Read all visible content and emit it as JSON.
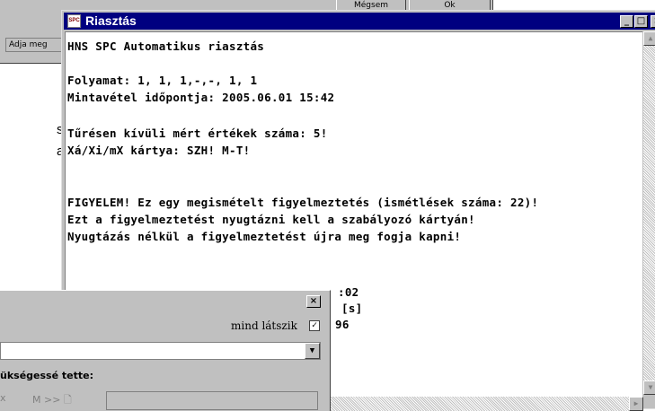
{
  "background_window": {
    "buttons": [
      "Mégsem",
      "Ok"
    ],
    "prompt_text": "Adja meg"
  },
  "side_text": [
    "s",
    "a"
  ],
  "alert": {
    "title": "Riasztás",
    "icon_label": "SPC",
    "controls": {
      "minimize": "_",
      "maximize": "□",
      "close": "×"
    },
    "lines": [
      "HNS SPC Automatikus riasztás",
      "",
      "Folyamat: 1, 1, 1,-,-, 1, 1",
      "Mintavétel időpontja: 2005.06.01 15:42",
      "",
      "Tűrésen kívüli mért értékek száma: 5!",
      "Xá/Xi/mX kártya: SZH! M-T!",
      "",
      "FIGYELEM! Ez egy megismételt figyelmeztetés (ismétlések száma: 22)!",
      "Ezt a figyelmeztetést nyugtázni kell a szabályozó kártyán!",
      "Nyugtázás nélkül a figyelmeztetést újra meg fogja kapni!"
    ],
    "partial_lines": [
      ":02",
      "[s]",
      "96"
    ],
    "scroll_up": "▲",
    "scroll_down": "▼",
    "scroll_right": "▶"
  },
  "dialog": {
    "close": "×",
    "show_all_label": "mind látszik",
    "show_all_checked": "✓",
    "combo_arrow": "▼",
    "made_necessary_label": "ükségessé tette:",
    "partial_x": "x",
    "nav_buttons": "M  >>  🗋"
  }
}
